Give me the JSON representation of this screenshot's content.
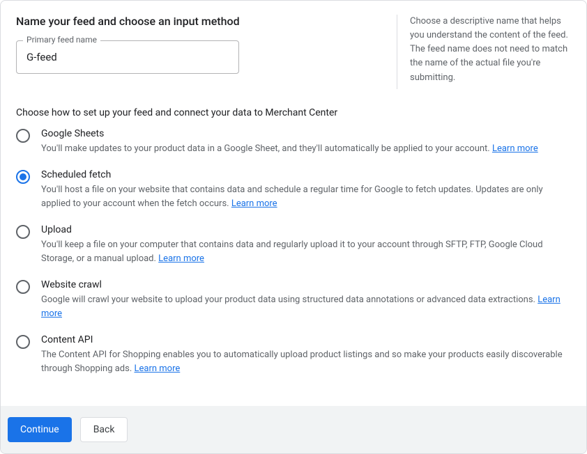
{
  "heading": "Name your feed and choose an input method",
  "feedNameLabel": "Primary feed name",
  "feedNameValue": "G-feed",
  "helpText": "Choose a descriptive name that helps you understand the content of the feed. The feed name does not need to match the name of the actual file you're submitting.",
  "subheading": "Choose how to set up your feed and connect your data to Merchant Center",
  "learnMoreLabel": "Learn more",
  "options": [
    {
      "title": "Google Sheets",
      "desc": "You'll make updates to your product data in a Google Sheet, and they'll automatically be applied to your account. ",
      "selected": false
    },
    {
      "title": "Scheduled fetch",
      "desc": "You'll host a file on your website that contains data and schedule a regular time for Google to fetch updates. Updates are only applied to your account when the fetch occurs. ",
      "selected": true
    },
    {
      "title": "Upload",
      "desc": "You'll keep a file on your computer that contains data and regularly upload it to your account through SFTP, FTP, Google Cloud Storage, or a manual upload. ",
      "selected": false
    },
    {
      "title": "Website crawl",
      "desc": "Google will crawl your website to upload your product data using structured data annotations or advanced data extractions. ",
      "selected": false
    },
    {
      "title": "Content API",
      "desc": "The Content API for Shopping enables you to automatically upload product listings and so make your products easily discoverable through Shopping ads. ",
      "selected": false
    }
  ],
  "buttons": {
    "continue": "Continue",
    "back": "Back"
  }
}
